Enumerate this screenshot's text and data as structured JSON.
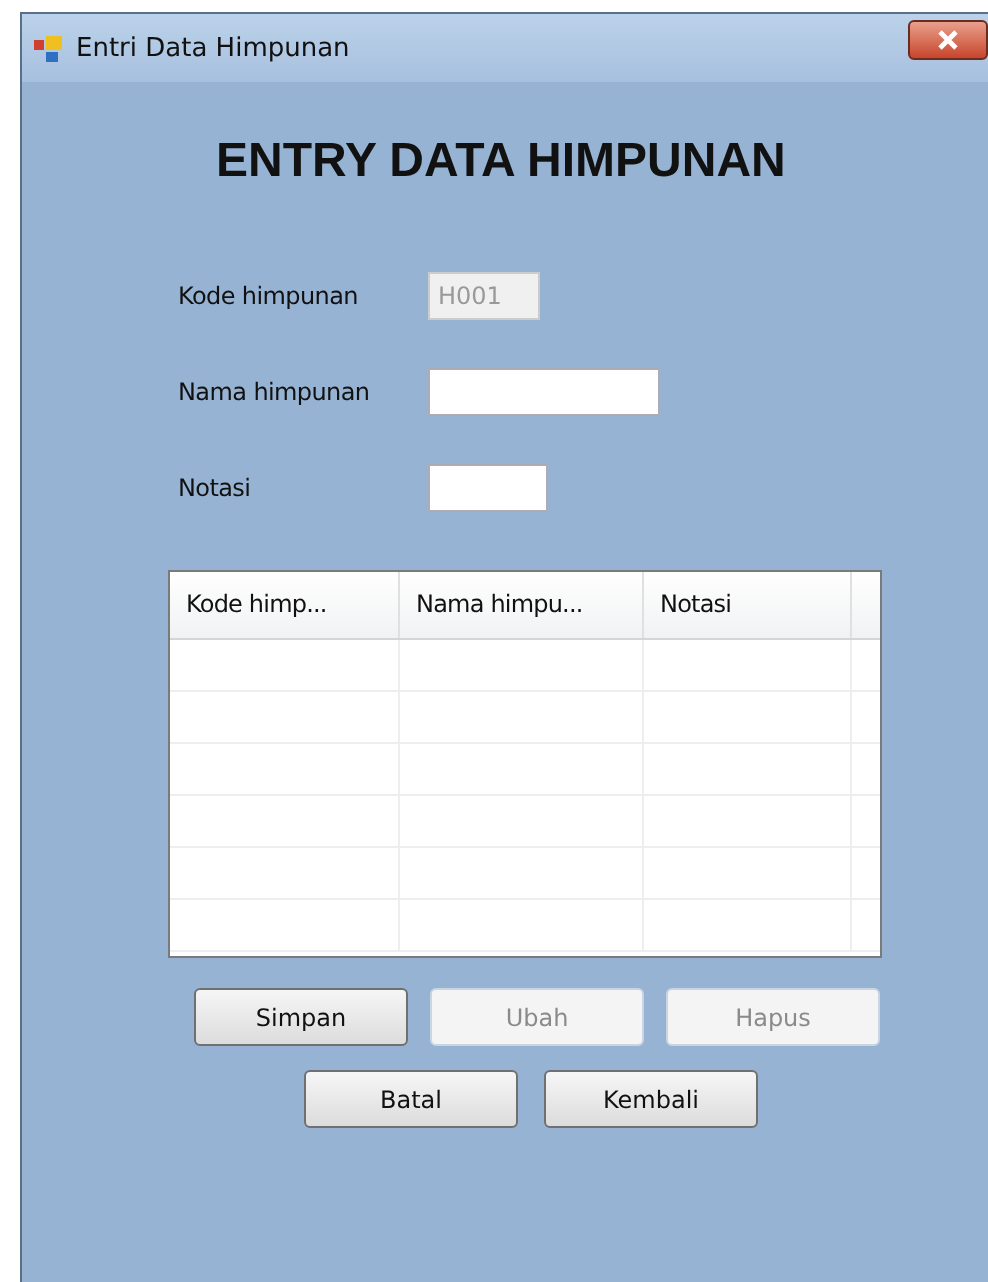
{
  "window": {
    "title": "Entri Data Himpunan"
  },
  "heading": "ENTRY DATA HIMPUNAN",
  "fields": [
    {
      "label": "Kode himpunan",
      "value": "H001",
      "disabled": true
    },
    {
      "label": "Nama himpunan",
      "disabled": false
    },
    {
      "label": "Notasi",
      "disabled": false
    }
  ],
  "table": {
    "columns": [
      "Kode himp...",
      "Nama himpu...",
      "Notasi"
    ]
  },
  "buttons": [
    [
      {
        "label": "Simpan",
        "disabled": false
      },
      {
        "label": "Ubah",
        "disabled": true
      },
      {
        "label": "Hapus",
        "disabled": true
      }
    ],
    [
      {
        "label": "Batal",
        "disabled": false
      },
      {
        "label": "Kembali",
        "disabled": false
      }
    ]
  ]
}
